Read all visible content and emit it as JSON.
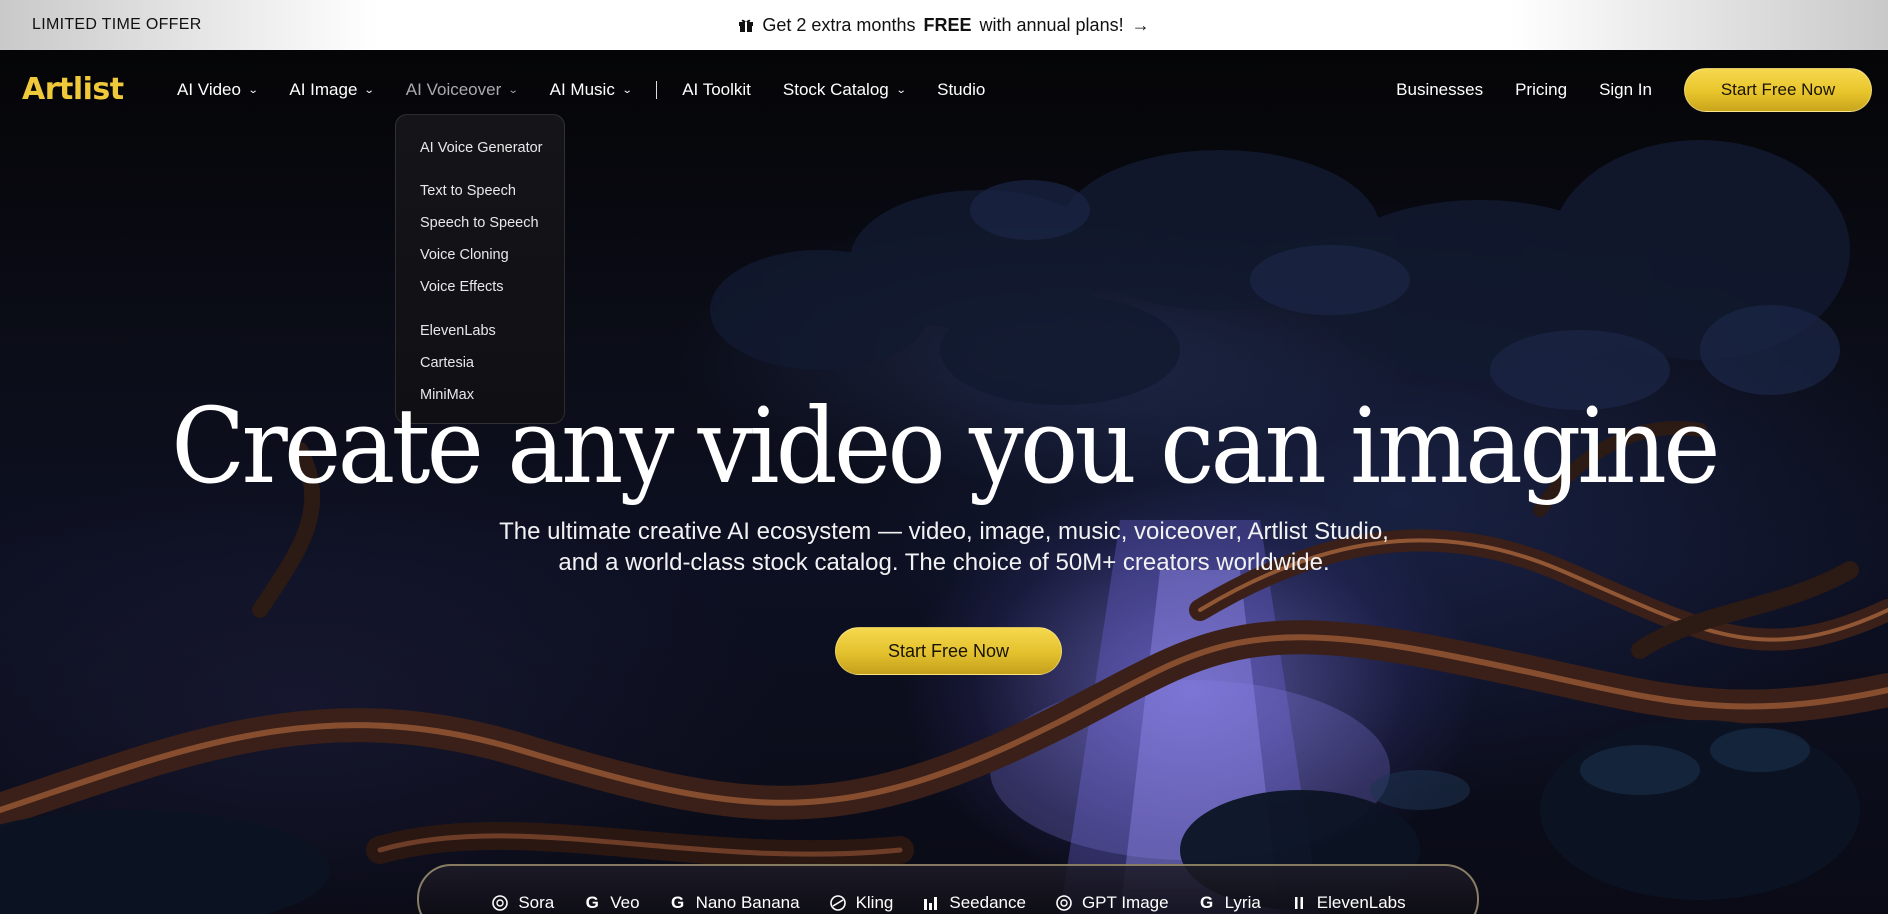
{
  "promo": {
    "offer_label": "LIMITED TIME OFFER",
    "message_prefix": "Get 2 extra months",
    "message_bold": "FREE",
    "message_suffix": "with annual plans!",
    "arrow": "→",
    "icon": "gift-icon"
  },
  "nav": {
    "logo": "Artlist",
    "brand_color": "#f0c93a",
    "left_items": [
      {
        "label": "AI Video",
        "has_menu": true
      },
      {
        "label": "AI Image",
        "has_menu": true
      },
      {
        "label": "AI Voiceover",
        "has_menu": true,
        "active": true
      },
      {
        "label": "AI Music",
        "has_menu": true
      },
      {
        "label": "AI Toolkit",
        "has_menu": false
      },
      {
        "label": "Stock Catalog",
        "has_menu": true
      },
      {
        "label": "Studio",
        "has_menu": false
      }
    ],
    "right_items": [
      {
        "label": "Businesses"
      },
      {
        "label": "Pricing"
      },
      {
        "label": "Sign In"
      }
    ],
    "cta_label": "Start Free Now"
  },
  "dropdown": {
    "group1": [
      "AI Voice Generator"
    ],
    "group2": [
      "Text to Speech",
      "Speech to Speech",
      "Voice Cloning",
      "Voice Effects"
    ],
    "group3": [
      "ElevenLabs",
      "Cartesia",
      "MiniMax"
    ]
  },
  "hero": {
    "headline": "Create any video you can imagine",
    "subline_1": "The ultimate creative AI ecosystem — video, image, music, voiceover, Artlist Studio,",
    "subline_2": "and a world-class stock catalog. The choice of 50M+ creators worldwide.",
    "cta_label": "Start Free Now",
    "accent_color": "#e8c52b"
  },
  "models": [
    {
      "label": "Sora",
      "icon": "openai-icon"
    },
    {
      "label": "Veo",
      "icon": "google-icon"
    },
    {
      "label": "Nano Banana",
      "icon": "google-icon"
    },
    {
      "label": "Kling",
      "icon": "kling-icon"
    },
    {
      "label": "Seedance",
      "icon": "seedance-icon"
    },
    {
      "label": "GPT Image",
      "icon": "openai-icon"
    },
    {
      "label": "Lyria",
      "icon": "google-icon"
    },
    {
      "label": "ElevenLabs",
      "icon": "elevenlabs-icon"
    }
  ]
}
